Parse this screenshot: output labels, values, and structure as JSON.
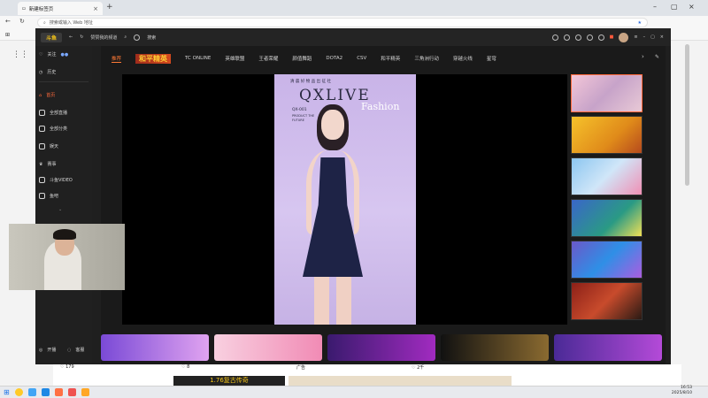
{
  "browser": {
    "tab_title": "新建标签页",
    "address_placeholder": "搜索或输入 Web 地址"
  },
  "app": {
    "title_link": "赞赞我的频道",
    "search_label": "搜索",
    "logo_text": "斗鱼"
  },
  "sidebar": {
    "items": [
      {
        "label": "关注"
      },
      {
        "label": "历史"
      },
      {
        "label": "首页"
      },
      {
        "label": "全部直播"
      },
      {
        "label": "全部分类"
      },
      {
        "label": "娱天"
      },
      {
        "label": "赛事"
      },
      {
        "label": "斗鱼VIDEO"
      },
      {
        "label": "鱼吧"
      }
    ],
    "bottom": [
      {
        "label": "开播"
      },
      {
        "label": "客服"
      }
    ]
  },
  "category_tabs": [
    {
      "label": "推荐"
    },
    {
      "label": "和平精英"
    },
    {
      "label": "TC ONLINE"
    },
    {
      "label": "英雄联盟"
    },
    {
      "label": "王者荣耀"
    },
    {
      "label": "颜值舞蹈"
    },
    {
      "label": "DOTA2"
    },
    {
      "label": "CSV"
    },
    {
      "label": "和平精英"
    },
    {
      "label": "三角洲行动"
    },
    {
      "label": "穿越火线"
    },
    {
      "label": "星穹"
    }
  ],
  "stream": {
    "header": "清 晨 好 物 品 出 征 社",
    "brand": "QXLIVE",
    "fashion": "Fashion",
    "code": "QX-001",
    "sub1": "PRODUCT THE",
    "sub2": "FUTURE"
  },
  "right_list": [
    {
      "name": "girl-group"
    },
    {
      "name": "promo-event"
    },
    {
      "name": "dnf-card"
    },
    {
      "name": "variety"
    },
    {
      "name": "tournament-s2"
    },
    {
      "name": "nbpl"
    }
  ],
  "webpage_below": {
    "count1": "179",
    "count2": "8",
    "count3": "2千",
    "ad": "广告",
    "banner_text": "1.76复古传奇"
  },
  "taskbar": {
    "time": "16:53",
    "date": "2025/8/10"
  },
  "colors": {
    "accent": "#ff6a3c",
    "brand_yellow": "#ffcc33"
  }
}
